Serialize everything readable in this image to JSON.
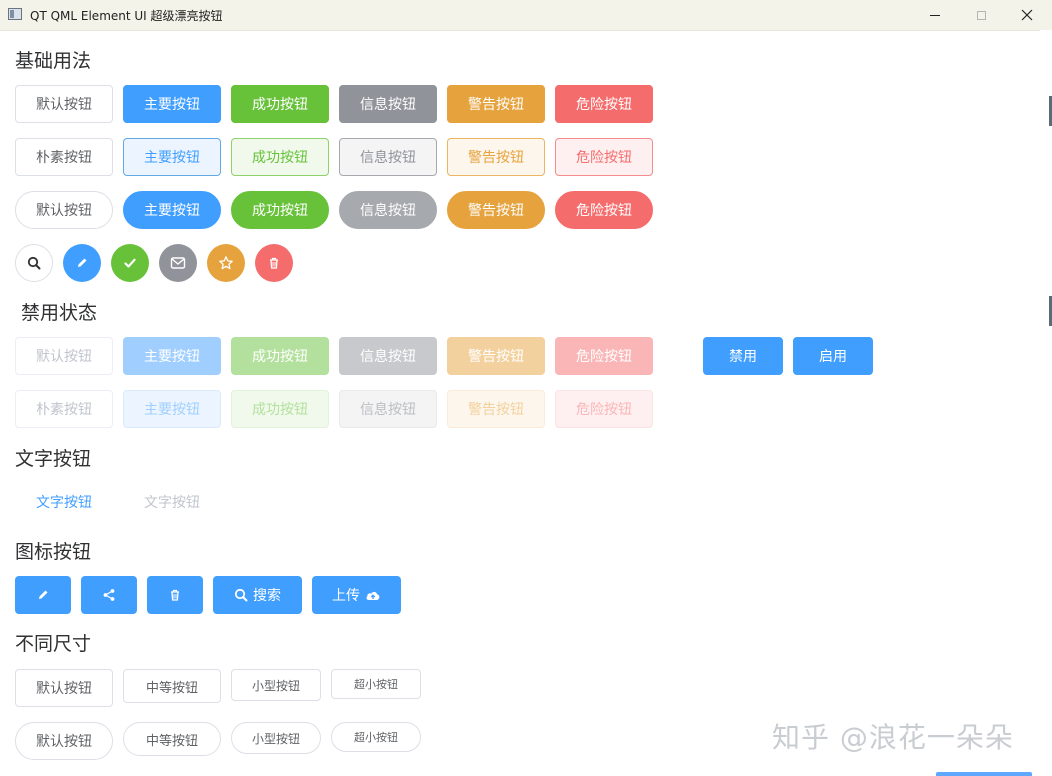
{
  "window": {
    "title": "QT QML Element UI 超级漂亮按钮"
  },
  "sections": {
    "basic": "基础用法",
    "disabled": "禁用状态",
    "text": "文字按钮",
    "icon": "图标按钮",
    "size": "不同尺寸"
  },
  "basic": {
    "row1": [
      "默认按钮",
      "主要按钮",
      "成功按钮",
      "信息按钮",
      "警告按钮",
      "危险按钮"
    ],
    "row2": [
      "朴素按钮",
      "主要按钮",
      "成功按钮",
      "信息按钮",
      "警告按钮",
      "危险按钮"
    ],
    "row3": [
      "默认按钮",
      "主要按钮",
      "成功按钮",
      "信息按钮",
      "警告按钮",
      "危险按钮"
    ],
    "circle_icons": [
      "search-icon",
      "edit-icon",
      "check-icon",
      "message-icon",
      "star-icon",
      "delete-icon"
    ]
  },
  "disabled": {
    "row1": [
      "默认按钮",
      "主要按钮",
      "成功按钮",
      "信息按钮",
      "警告按钮",
      "危险按钮"
    ],
    "row2": [
      "朴素按钮",
      "主要按钮",
      "成功按钮",
      "信息按钮",
      "警告按钮",
      "危险按钮"
    ],
    "toggle_disable": "禁用",
    "toggle_enable": "启用"
  },
  "text_buttons": {
    "normal": "文字按钮",
    "disabled": "文字按钮"
  },
  "icon_buttons": {
    "icons": [
      "edit-icon",
      "share-icon",
      "delete-icon"
    ],
    "search": "搜索",
    "upload": "上传"
  },
  "sizes": {
    "row1": [
      "默认按钮",
      "中等按钮",
      "小型按钮",
      "超小按钮"
    ],
    "row2": [
      "默认按钮",
      "中等按钮",
      "小型按钮",
      "超小按钮"
    ]
  },
  "watermark": "知乎 @浪花一朵朵",
  "colors": {
    "primary": "#409eff",
    "success": "#67c23a",
    "info": "#909399",
    "warning": "#e6a23c",
    "danger": "#f56c6c"
  }
}
